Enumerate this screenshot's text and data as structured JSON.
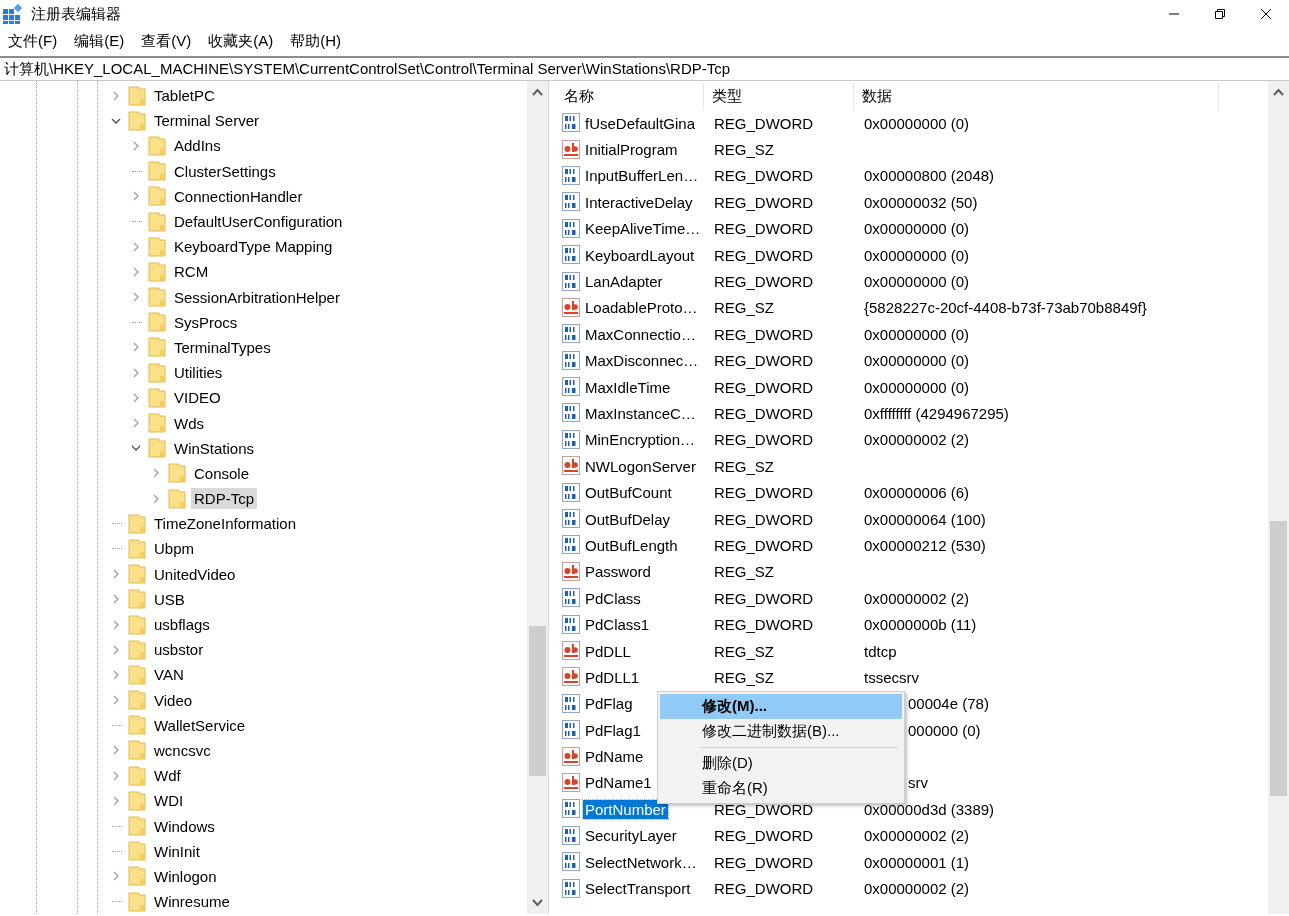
{
  "window": {
    "title": "注册表编辑器"
  },
  "menu_bar": [
    "文件(F)",
    "编辑(E)",
    "查看(V)",
    "收藏夹(A)",
    "帮助(H)"
  ],
  "address_bar": {
    "path": "计算机\\HKEY_LOCAL_MACHINE\\SYSTEM\\CurrentControlSet\\Control\\Terminal Server\\WinStations\\RDP-Tcp"
  },
  "tree": [
    {
      "label": "TabletPC",
      "has_children": true,
      "expanded": false,
      "selected": false
    },
    {
      "label": "Terminal Server",
      "has_children": true,
      "expanded": true,
      "selected": false,
      "children": [
        {
          "label": "AddIns",
          "has_children": true,
          "expanded": false,
          "selected": false
        },
        {
          "label": "ClusterSettings",
          "has_children": false,
          "selected": false
        },
        {
          "label": "ConnectionHandler",
          "has_children": true,
          "expanded": false,
          "selected": false
        },
        {
          "label": "DefaultUserConfiguration",
          "has_children": false,
          "selected": false
        },
        {
          "label": "KeyboardType Mapping",
          "has_children": true,
          "expanded": false,
          "selected": false
        },
        {
          "label": "RCM",
          "has_children": true,
          "expanded": false,
          "selected": false
        },
        {
          "label": "SessionArbitrationHelper",
          "has_children": true,
          "expanded": false,
          "selected": false
        },
        {
          "label": "SysProcs",
          "has_children": false,
          "selected": false
        },
        {
          "label": "TerminalTypes",
          "has_children": true,
          "expanded": false,
          "selected": false
        },
        {
          "label": "Utilities",
          "has_children": true,
          "expanded": false,
          "selected": false
        },
        {
          "label": "VIDEO",
          "has_children": true,
          "expanded": false,
          "selected": false
        },
        {
          "label": "Wds",
          "has_children": true,
          "expanded": false,
          "selected": false
        },
        {
          "label": "WinStations",
          "has_children": true,
          "expanded": true,
          "selected": false,
          "children": [
            {
              "label": "Console",
              "has_children": true,
              "expanded": false,
              "selected": false
            },
            {
              "label": "RDP-Tcp",
              "has_children": true,
              "expanded": false,
              "selected": true
            }
          ]
        }
      ]
    },
    {
      "label": "TimeZoneInformation",
      "has_children": false,
      "selected": false
    },
    {
      "label": "Ubpm",
      "has_children": false,
      "selected": false
    },
    {
      "label": "UnitedVideo",
      "has_children": true,
      "expanded": false,
      "selected": false
    },
    {
      "label": "USB",
      "has_children": true,
      "expanded": false,
      "selected": false
    },
    {
      "label": "usbflags",
      "has_children": true,
      "expanded": false,
      "selected": false
    },
    {
      "label": "usbstor",
      "has_children": true,
      "expanded": false,
      "selected": false
    },
    {
      "label": "VAN",
      "has_children": true,
      "expanded": false,
      "selected": false
    },
    {
      "label": "Video",
      "has_children": true,
      "expanded": false,
      "selected": false
    },
    {
      "label": "WalletService",
      "has_children": false,
      "selected": false
    },
    {
      "label": "wcncsvc",
      "has_children": true,
      "expanded": false,
      "selected": false
    },
    {
      "label": "Wdf",
      "has_children": true,
      "expanded": false,
      "selected": false
    },
    {
      "label": "WDI",
      "has_children": true,
      "expanded": false,
      "selected": false
    },
    {
      "label": "Windows",
      "has_children": false,
      "selected": false
    },
    {
      "label": "WinInit",
      "has_children": false,
      "selected": false
    },
    {
      "label": "Winlogon",
      "has_children": true,
      "expanded": false,
      "selected": false
    },
    {
      "label": "Winresume",
      "has_children": false,
      "selected": false
    }
  ],
  "values": {
    "columns": [
      "名称",
      "类型",
      "数据"
    ],
    "rows": [
      {
        "kind": "dword",
        "name": "fUseDefaultGina",
        "type": "REG_DWORD",
        "data": "0x00000000 (0)",
        "selected": false
      },
      {
        "kind": "sz",
        "name": "InitialProgram",
        "type": "REG_SZ",
        "selected": false
      },
      {
        "kind": "dword",
        "name": "InputBufferLen…",
        "type": "REG_DWORD",
        "data": "0x00000800 (2048)",
        "selected": false
      },
      {
        "kind": "dword",
        "name": "InteractiveDelay",
        "type": "REG_DWORD",
        "data": "0x00000032 (50)",
        "selected": false
      },
      {
        "kind": "dword",
        "name": "KeepAliveTime…",
        "type": "REG_DWORD",
        "data": "0x00000000 (0)",
        "selected": false
      },
      {
        "kind": "dword",
        "name": "KeyboardLayout",
        "type": "REG_DWORD",
        "data": "0x00000000 (0)",
        "selected": false
      },
      {
        "kind": "dword",
        "name": "LanAdapter",
        "type": "REG_DWORD",
        "data": "0x00000000 (0)",
        "selected": false
      },
      {
        "kind": "sz",
        "name": "LoadableProto…",
        "type": "REG_SZ",
        "data": "{5828227c-20cf-4408-b73f-73ab70b8849f}",
        "selected": false
      },
      {
        "kind": "dword",
        "name": "MaxConnectio…",
        "type": "REG_DWORD",
        "data": "0x00000000 (0)",
        "selected": false
      },
      {
        "kind": "dword",
        "name": "MaxDisconnec…",
        "type": "REG_DWORD",
        "data": "0x00000000 (0)",
        "selected": false
      },
      {
        "kind": "dword",
        "name": "MaxIdleTime",
        "type": "REG_DWORD",
        "data": "0x00000000 (0)",
        "selected": false
      },
      {
        "kind": "dword",
        "name": "MaxInstanceC…",
        "type": "REG_DWORD",
        "data": "0xffffffff (4294967295)",
        "selected": false
      },
      {
        "kind": "dword",
        "name": "MinEncryption…",
        "type": "REG_DWORD",
        "data": "0x00000002 (2)",
        "selected": false
      },
      {
        "kind": "sz",
        "name": "NWLogonServer",
        "type": "REG_SZ",
        "selected": false
      },
      {
        "kind": "dword",
        "name": "OutBufCount",
        "type": "REG_DWORD",
        "data": "0x00000006 (6)",
        "selected": false
      },
      {
        "kind": "dword",
        "name": "OutBufDelay",
        "type": "REG_DWORD",
        "data": "0x00000064 (100)",
        "selected": false
      },
      {
        "kind": "dword",
        "name": "OutBufLength",
        "type": "REG_DWORD",
        "data": "0x00000212 (530)",
        "selected": false
      },
      {
        "kind": "sz",
        "name": "Password",
        "type": "REG_SZ",
        "selected": false
      },
      {
        "kind": "dword",
        "name": "PdClass",
        "type": "REG_DWORD",
        "data": "0x00000002 (2)",
        "selected": false
      },
      {
        "kind": "dword",
        "name": "PdClass1",
        "type": "REG_DWORD",
        "data": "0x0000000b (11)",
        "selected": false
      },
      {
        "kind": "sz",
        "name": "PdDLL",
        "type": "REG_SZ",
        "data": "tdtcp",
        "selected": false
      },
      {
        "kind": "sz",
        "name": "PdDLL1",
        "type": "REG_SZ",
        "data": "tssecsrv",
        "selected": false
      },
      {
        "kind": "dword",
        "name": "PdFlag",
        "data": "00004e (78)",
        "partly_hidden": true,
        "selected": false
      },
      {
        "kind": "dword",
        "name": "PdFlag1",
        "data": "000000 (0)",
        "partly_hidden": true,
        "selected": false
      },
      {
        "kind": "sz",
        "name": "PdName",
        "selected": false
      },
      {
        "kind": "sz",
        "name": "PdName1",
        "data": "srv",
        "partly_hidden": true,
        "selected": false
      },
      {
        "kind": "dword",
        "name": "PortNumber",
        "type": "REG_DWORD",
        "data": "0x00000d3d (3389)",
        "selected": true
      },
      {
        "kind": "dword",
        "name": "SecurityLayer",
        "type": "REG_DWORD",
        "data": "0x00000002 (2)",
        "selected": false
      },
      {
        "kind": "dword",
        "name": "SelectNetwork…",
        "type": "REG_DWORD",
        "data": "0x00000001 (1)",
        "selected": false
      },
      {
        "kind": "dword",
        "name": "SelectTransport",
        "type": "REG_DWORD",
        "data": "0x00000002 (2)",
        "selected": false
      }
    ]
  },
  "context_menu": {
    "items": [
      {
        "kind": "item",
        "label": "修改(M)...",
        "default": true,
        "selected": true
      },
      {
        "kind": "item",
        "label": "修改二进制数据(B)...",
        "default": false,
        "selected": false
      },
      {
        "kind": "separator"
      },
      {
        "kind": "item",
        "label": "删除(D)",
        "default": false,
        "selected": false
      },
      {
        "kind": "item",
        "label": "重命名(R)",
        "default": false,
        "selected": false
      }
    ]
  }
}
